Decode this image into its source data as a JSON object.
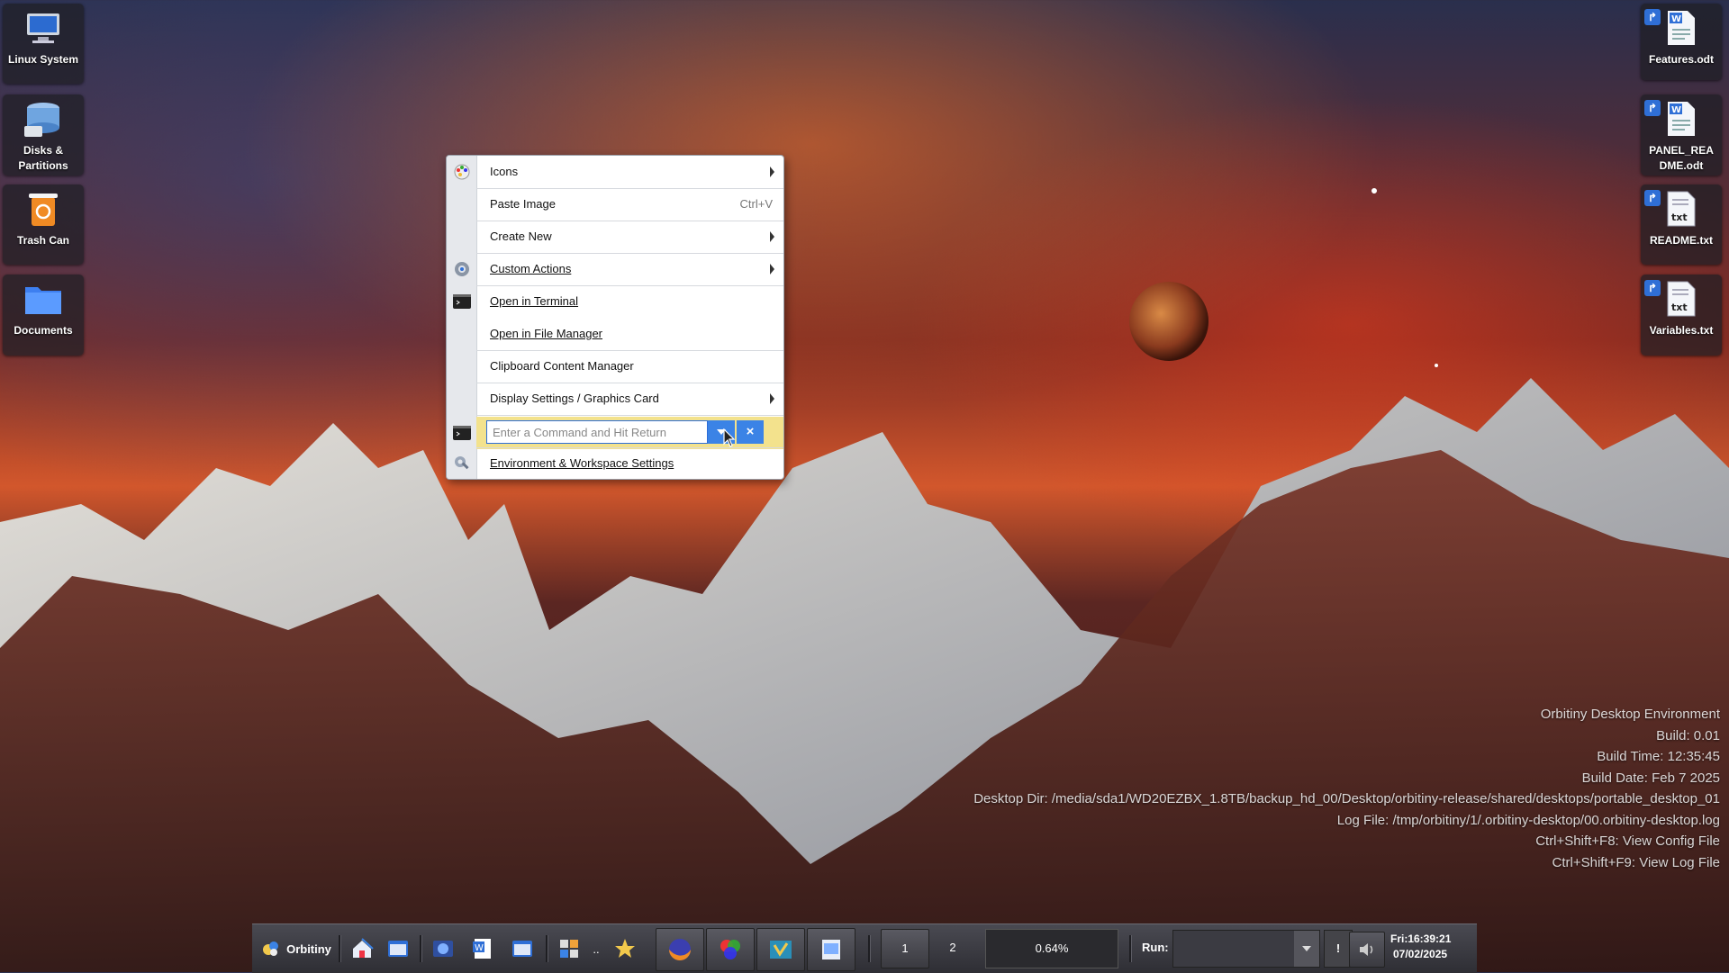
{
  "desktop_icons_left": [
    {
      "label": "Linux System",
      "icon": "computer-icon"
    },
    {
      "label": "Disks & Partitions",
      "icon": "disks-icon"
    },
    {
      "label": "Trash Can",
      "icon": "trash-icon"
    },
    {
      "label": "Documents",
      "icon": "folder-icon"
    }
  ],
  "desktop_icons_right": [
    {
      "label": "Features.odt",
      "icon": "writer-doc-icon"
    },
    {
      "label": "PANEL_README.odt",
      "icon": "writer-doc-icon"
    },
    {
      "label": "README.txt",
      "icon": "text-file-icon"
    },
    {
      "label": "Variables.txt",
      "icon": "text-file-icon"
    }
  ],
  "context_menu": {
    "items": [
      {
        "label": "Icons"
      },
      {
        "label": "Paste Image",
        "shortcut": "Ctrl+V"
      },
      {
        "label": "Create New"
      },
      {
        "label": "Custom Actions"
      },
      {
        "label": "Open in Terminal"
      },
      {
        "label": "Open in File Manager"
      },
      {
        "label": "Clipboard Content Manager"
      },
      {
        "label": "Display Settings / Graphics Card"
      },
      {
        "label": "Environment & Workspace Settings"
      }
    ],
    "command_placeholder": "Enter a Command and Hit Return",
    "clear_label": "×"
  },
  "info": {
    "lines": [
      "Orbitiny Desktop Environment",
      "Build: 0.01",
      "Build Time: 12:35:45",
      "Build Date: Feb  7 2025",
      "Desktop Dir: /media/sda1/WD20EZBX_1.8TB/backup_hd_00/Desktop/orbitiny-release/shared/desktops/portable_desktop_01",
      "Log File: /tmp/orbitiny/1/.orbitiny-desktop/00.orbitiny-desktop.log",
      "Ctrl+Shift+F8: View Config File",
      "Ctrl+Shift+F9: View Log File"
    ]
  },
  "taskbar": {
    "start_label": "Orbitiny",
    "workspaces": [
      "1",
      "2"
    ],
    "cpu": "0.64%",
    "run_label": "Run:",
    "run_go": "!",
    "clock_time": "Fri:16:39:21",
    "clock_date": "07/02/2025",
    "more_label": ".."
  },
  "colors": {
    "accent": "#3b83e6",
    "command_row": "#f3e28d"
  }
}
